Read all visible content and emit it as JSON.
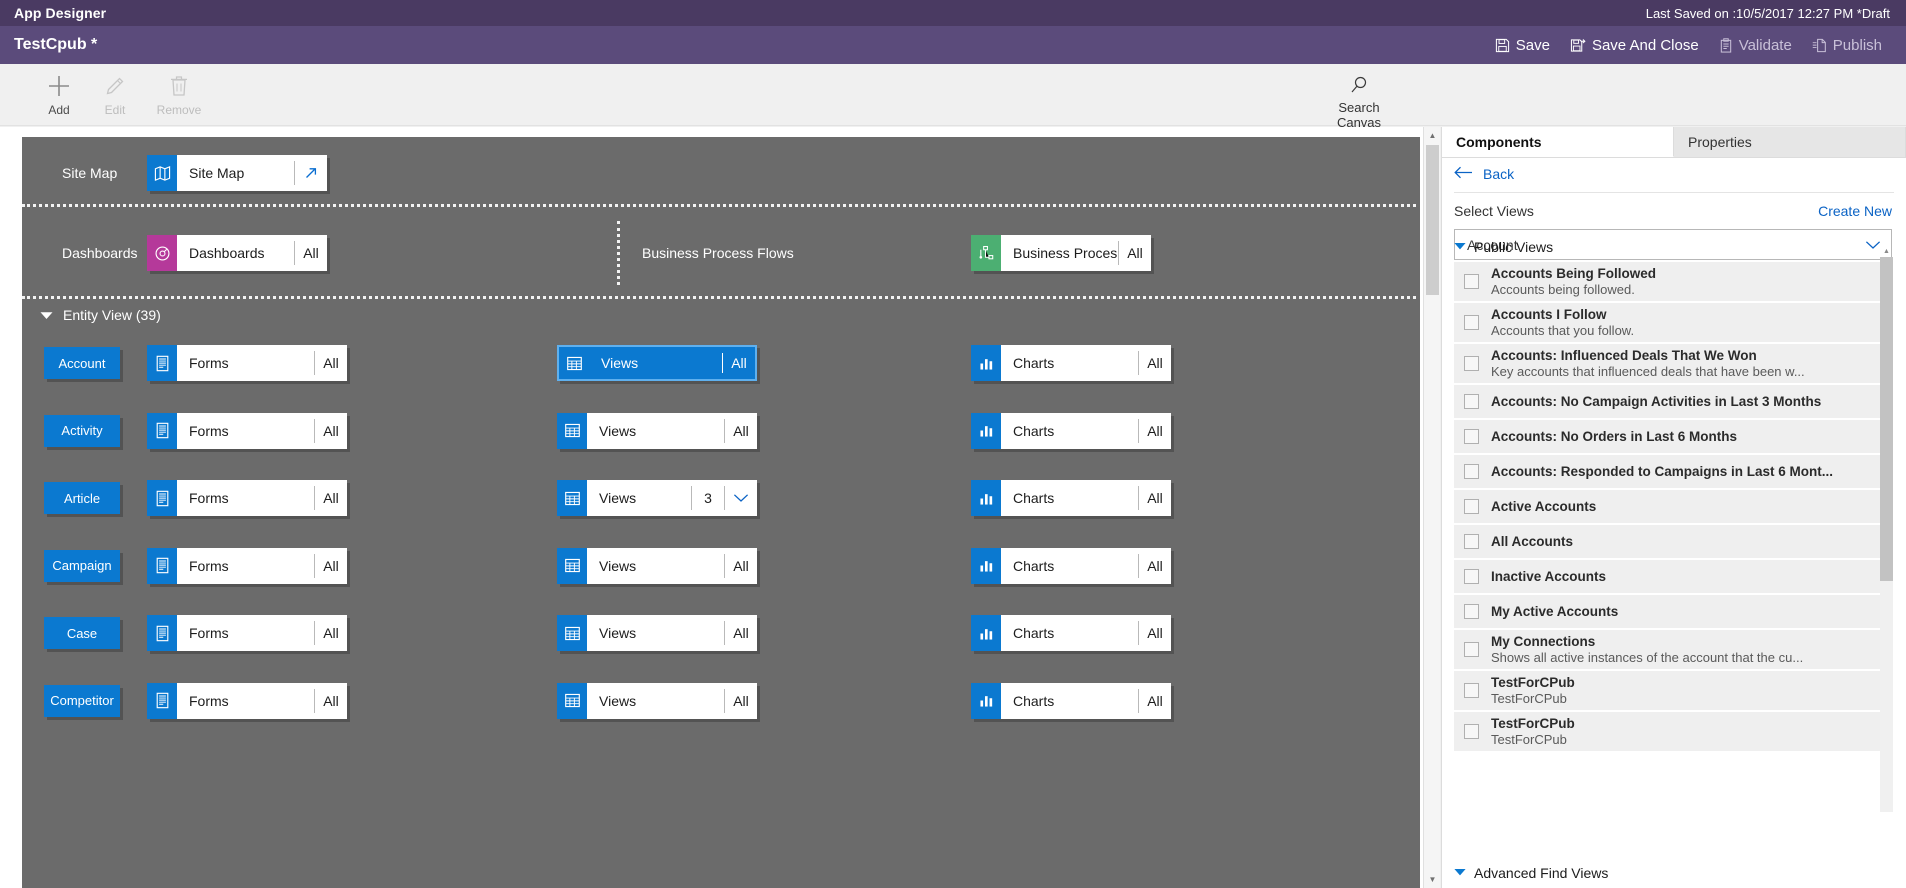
{
  "titlebar": {
    "app_title": "App Designer",
    "last_saved": "Last Saved on :10/5/2017 12:27 PM *Draft"
  },
  "commandbar": {
    "doc_title": "TestCpub *",
    "actions": [
      {
        "label": "Save",
        "icon": "save-icon",
        "disabled": false
      },
      {
        "label": "Save And Close",
        "icon": "save-and-close-icon",
        "disabled": false
      },
      {
        "label": "Validate",
        "icon": "validate-icon",
        "disabled": true
      },
      {
        "label": "Publish",
        "icon": "publish-icon",
        "disabled": true
      }
    ]
  },
  "ribbon": {
    "items": [
      {
        "label": "Add",
        "icon": "plus-icon",
        "disabled": false
      },
      {
        "label": "Edit",
        "icon": "pencil-icon",
        "disabled": true
      },
      {
        "label": "Remove",
        "icon": "trash-icon",
        "disabled": true
      }
    ],
    "search_canvas": {
      "label": "Search Canvas",
      "icon": "search-icon"
    }
  },
  "canvas": {
    "sitemap_section": {
      "label": "Site Map",
      "tile": {
        "name": "Site Map",
        "icon": "sitemap-icon",
        "icon_color": "#0b79d0",
        "action": "open-designer-arrow-icon"
      }
    },
    "dashboards_section": {
      "label": "Dashboards",
      "tile": {
        "name": "Dashboards",
        "count": "All",
        "icon": "dashboard-icon",
        "icon_color": "#b5399a"
      }
    },
    "bpf_section": {
      "label": "Business Process Flows",
      "tile": {
        "name": "Business Proces...",
        "count": "All",
        "icon": "process-flow-icon",
        "icon_color": "#4caf72"
      }
    },
    "entity_view": {
      "header": "Entity View (39)",
      "columns": [
        "Forms",
        "Views",
        "Charts"
      ],
      "rows": [
        {
          "entity": "Account",
          "forms": "All",
          "views": "All",
          "views_selected": true,
          "views_dropdown": false,
          "charts": "All"
        },
        {
          "entity": "Activity",
          "forms": "All",
          "views": "All",
          "views_selected": false,
          "views_dropdown": false,
          "charts": "All"
        },
        {
          "entity": "Article",
          "forms": "All",
          "views": "3",
          "views_selected": false,
          "views_dropdown": true,
          "charts": "All"
        },
        {
          "entity": "Campaign",
          "forms": "All",
          "views": "All",
          "views_selected": false,
          "views_dropdown": false,
          "charts": "All"
        },
        {
          "entity": "Case",
          "forms": "All",
          "views": "All",
          "views_selected": false,
          "views_dropdown": false,
          "charts": "All"
        },
        {
          "entity": "Competitor",
          "forms": "All",
          "views": "All",
          "views_selected": false,
          "views_dropdown": false,
          "charts": "All"
        }
      ]
    }
  },
  "right_panel": {
    "tabs": [
      {
        "label": "Components",
        "active": true
      },
      {
        "label": "Properties",
        "active": false
      }
    ],
    "back_label": "Back",
    "select_label": "Select Views",
    "create_new_label": "Create New",
    "entity_dropdown_value": "Account",
    "public_views_group": "Public Views",
    "advanced_find_group": "Advanced Find Views",
    "views": [
      {
        "title": "Accounts Being Followed",
        "desc": "Accounts being followed.",
        "checked": false
      },
      {
        "title": "Accounts I Follow",
        "desc": "Accounts that you follow.",
        "checked": false
      },
      {
        "title": "Accounts: Influenced Deals That We Won",
        "desc": "Key accounts that influenced deals that have been w...",
        "checked": false
      },
      {
        "title": "Accounts: No Campaign Activities in Last 3 Months",
        "desc": "",
        "checked": false
      },
      {
        "title": "Accounts: No Orders in Last 6 Months",
        "desc": "",
        "checked": false
      },
      {
        "title": "Accounts: Responded to Campaigns in Last 6 Mont...",
        "desc": "",
        "checked": false
      },
      {
        "title": "Active Accounts",
        "desc": "",
        "checked": false
      },
      {
        "title": "All Accounts",
        "desc": "",
        "checked": false
      },
      {
        "title": "Inactive Accounts",
        "desc": "",
        "checked": false
      },
      {
        "title": "My Active Accounts",
        "desc": "",
        "checked": false
      },
      {
        "title": "My Connections",
        "desc": "Shows all active instances of the account that the cu...",
        "checked": false
      },
      {
        "title": "TestForCPub",
        "desc": "TestForCPub",
        "checked": false
      },
      {
        "title": "TestForCPub",
        "desc": "TestForCPub",
        "checked": false
      }
    ]
  },
  "colors": {
    "title_purple": "#4a3a62",
    "command_purple": "#5b4b7b",
    "canvas_grey": "#6b6b6b",
    "accent_blue": "#0b79d0",
    "magenta": "#b5399a",
    "green": "#4caf72"
  }
}
